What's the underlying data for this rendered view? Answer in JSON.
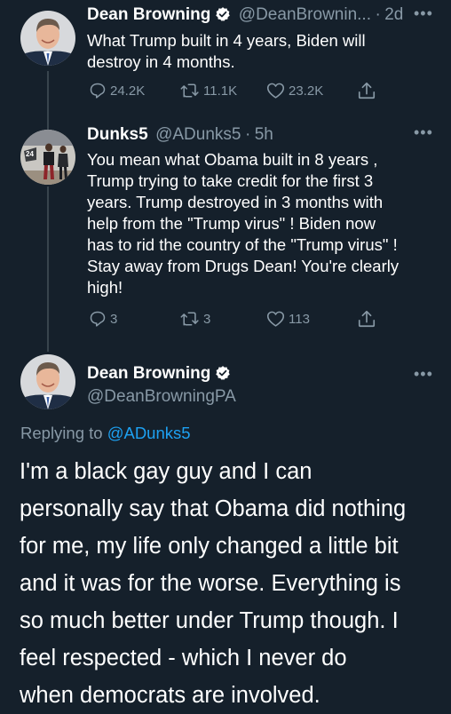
{
  "tweets": [
    {
      "author_name": "Dean Browning",
      "author_handle": "@DeanBrownin...",
      "separator": "·",
      "time": "2d",
      "text_lines": [
        "What Trump built in 4 years, Biden will",
        "destroy in 4 months."
      ],
      "replies": "24.2K",
      "retweets": "11.1K",
      "likes": "23.2K",
      "verified": true
    },
    {
      "author_name": "Dunks5",
      "author_handle": "@ADunks5",
      "separator": "·",
      "time": "5h",
      "text_lines": [
        "You mean what Obama built in 8 years ,",
        "Trump trying to take credit for the first 3",
        "years. Trump destroyed in 3 months with",
        "help from the \"Trump virus\" ! Biden now",
        "has to rid the country of the \"Trump virus\" !",
        "Stay away from Drugs Dean! You're clearly",
        "high!"
      ],
      "replies": "3",
      "retweets": "3",
      "likes": "113",
      "verified": false
    }
  ],
  "main_tweet": {
    "author_name": "Dean Browning",
    "author_handle": "@DeanBrowningPA",
    "replying_prefix": "Replying to",
    "replying_to": "@ADunks5",
    "text_lines": [
      "I'm a black gay guy and I can",
      "personally say that Obama did nothing",
      "for me, my life only changed a little bit",
      "and it was for the worse. Everything is",
      "so much better under Trump though. I",
      "feel respected - which I never do",
      "when democrats are involved."
    ],
    "verified": true
  },
  "icons": {
    "reply": "reply-icon",
    "retweet": "retweet-icon",
    "like": "heart-icon",
    "share": "share-icon",
    "more": "more-icon",
    "verified": "verified-badge-icon"
  },
  "colors": {
    "background": "#15202b",
    "muted": "#8899a6",
    "link": "#1da1f2",
    "thread_line": "#38444d"
  }
}
